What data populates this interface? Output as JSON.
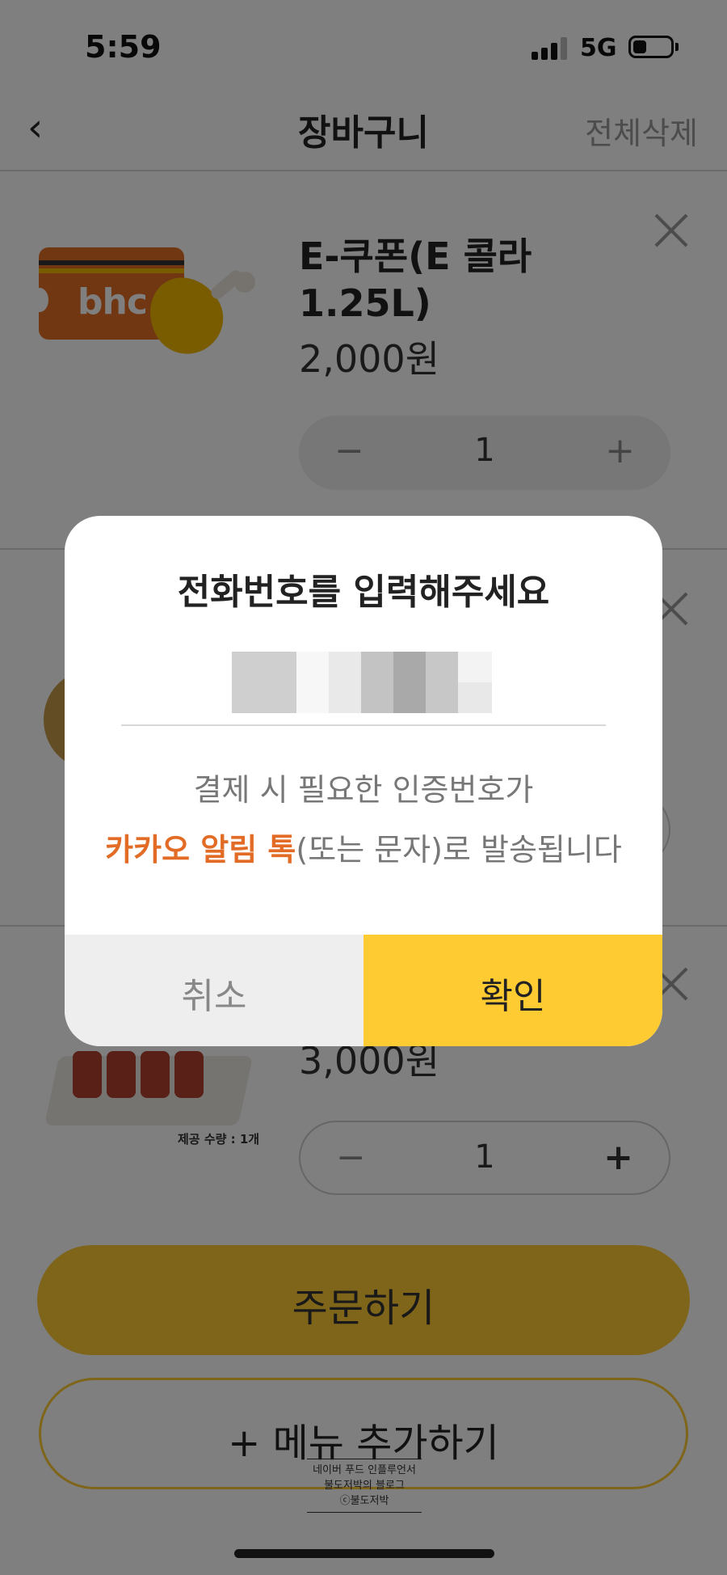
{
  "status_bar": {
    "time": "5:59",
    "network": "5G"
  },
  "header": {
    "back_icon": "chevron-left-icon",
    "title": "장바구니",
    "clear_all": "전체삭제"
  },
  "items": [
    {
      "name": "E-쿠폰(E 콜라1.25L)",
      "price": "2,000원",
      "quantity": "1",
      "image_text": "bhc"
    },
    {
      "name": "",
      "price": "",
      "quantity": ""
    },
    {
      "name": "",
      "price": "3,000원",
      "quantity": "1",
      "image_caption": "제공 수량 : 1개"
    }
  ],
  "stepper": {
    "minus": "−",
    "plus": "+"
  },
  "bottom": {
    "order_button": "주문하기",
    "add_menu_button": "+ 메뉴 추가하기"
  },
  "watermark": {
    "line1": "네이버 푸드 인플루언서",
    "line2": "불도저박의 블로그",
    "line3": "ⓒ불도저박"
  },
  "modal": {
    "title": "전화번호를 입력해주세요",
    "phone_masked": true,
    "description_line1": "결제 시 필요한 인증번호가",
    "description_highlight": "카카오 알림 톡",
    "description_rest": "(또는 문자)로 발송됩니다",
    "cancel": "취소",
    "confirm": "확인"
  },
  "colors": {
    "accent": "#fecb32",
    "highlight": "#e26c25",
    "overlay": "rgba(0,0,0,0.5)"
  }
}
